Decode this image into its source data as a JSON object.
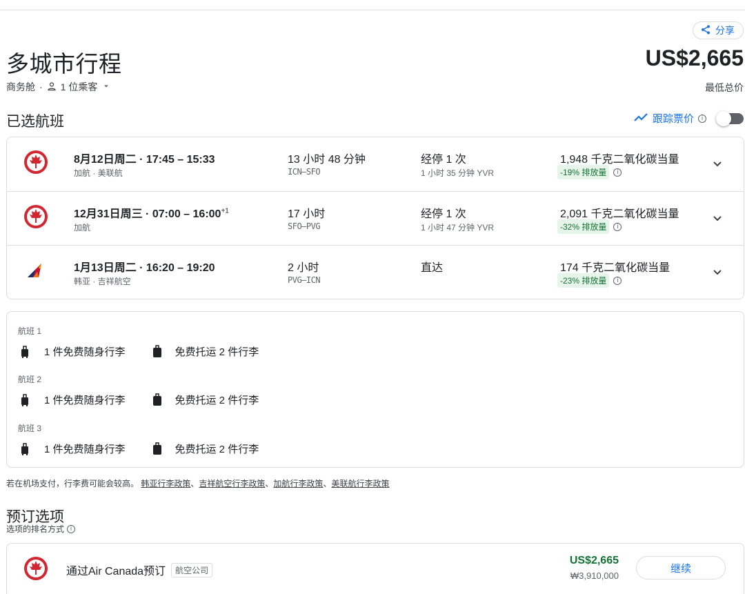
{
  "header": {
    "share_label": "分享",
    "title": "多城市行程",
    "total_price": "US$2,665",
    "cabin": "商务舱",
    "passengers": "1 位乘客",
    "price_note": "最低总价"
  },
  "selected": {
    "title": "已选航班",
    "track_label": "跟踪票价"
  },
  "flights": [
    {
      "date": "8月12日周二 · 17:45 – 15:33",
      "date_sup": "",
      "airline": "加航 · 美联航",
      "duration": "13 小时 48 分钟",
      "route": "ICN–SFO",
      "stops": "经停 1 次",
      "stop_detail": "1 小时 35 分钟 YVR",
      "co2": "1,948 千克二氧化碳当量",
      "emission": "-19% 排放量",
      "logo": "air-canada-logo"
    },
    {
      "date": "12月31日周三 · 07:00 – 16:00",
      "date_sup": "+1",
      "airline": "加航",
      "duration": "17 小时",
      "route": "SFO–PVG",
      "stops": "经停 1 次",
      "stop_detail": "1 小时 47 分钟 YVR",
      "co2": "2,091 千克二氧化碳当量",
      "emission": "-32% 排放量",
      "logo": "air-canada-logo"
    },
    {
      "date": "1月13日周二 · 16:20 – 19:20",
      "date_sup": "",
      "airline": "韩亚 · 吉祥航空",
      "duration": "2 小时",
      "route": "PVG–ICN",
      "stops": "直达",
      "stop_detail": "",
      "co2": "174 千克二氧化碳当量",
      "emission": "-23% 排放量",
      "logo": "asiana-logo"
    }
  ],
  "baggage": [
    {
      "flight": "航班 1",
      "carry_on": "1 件免费随身行李",
      "checked": "免费托运 2 件行李"
    },
    {
      "flight": "航班 2",
      "carry_on": "1 件免费随身行李",
      "checked": "免费托运 2 件行李"
    },
    {
      "flight": "航班 3",
      "carry_on": "1 件免费随身行李",
      "checked": "免费托运 2 件行李"
    }
  ],
  "policy": {
    "prefix": "若在机场支付，行李费可能会较高。",
    "links": [
      "韩亚行李政策",
      "吉祥航空行李政策",
      "加航行李政策",
      "美联航行李政策"
    ],
    "separator": "、"
  },
  "booking": {
    "title": "预订选项",
    "sort_label": "选项的排名方式",
    "option_name": "通过Air Canada预订",
    "option_tag": "航空公司",
    "price_usd": "US$2,665",
    "price_krw": "₩3,910,000",
    "continue_label": "继续"
  },
  "colors": {
    "accent": "#1a73e8",
    "green": "#137333",
    "air_canada_red": "#d22630"
  }
}
